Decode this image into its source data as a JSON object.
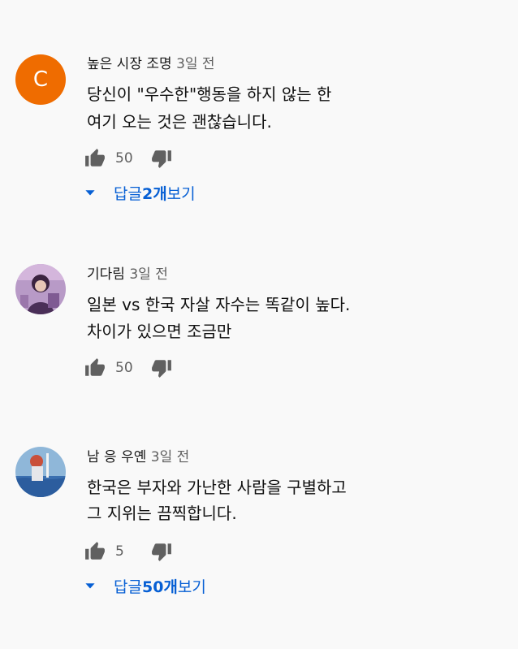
{
  "comments": [
    {
      "avatar_letter": "C",
      "avatar_color": "#ef6c00",
      "author": "높은 시장 조명",
      "time": "3일 전",
      "lines": [
        "당신이 \"우수한\"행동을 하지 않는 한",
        "여기 오는 것은 괜찮습니다."
      ],
      "likes": "50",
      "replies_prefix": "답글 ",
      "replies_count": "2개",
      "replies_suffix": " 보기"
    },
    {
      "avatar_letter": "",
      "author": "기다림",
      "time": "3일 전",
      "lines": [
        "일본 vs 한국 자살 자수는 똑같이 높다.",
        "차이가 있으면 조금만"
      ],
      "likes": "50"
    },
    {
      "avatar_letter": "",
      "author": "남 응 우옌",
      "time": "3일 전",
      "lines": [
        "한국은 부자와 가난한 사람을 구별하고",
        "그 지위는 끔찍합니다."
      ],
      "likes": "5",
      "replies_prefix": "답글 ",
      "replies_count": "50개",
      "replies_suffix": " 보기"
    }
  ],
  "icons": {
    "like": "thumb-up-icon",
    "dislike": "thumb-down-icon",
    "expand": "caret-down-icon"
  },
  "colors": {
    "link": "#065fd4",
    "meta": "#606060",
    "background": "#f9f9f9"
  }
}
